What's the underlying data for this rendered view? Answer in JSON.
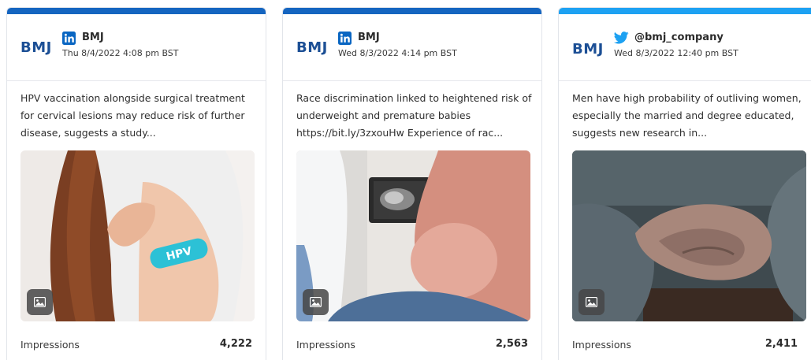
{
  "colors": {
    "linkedin_bar": "#1565c0",
    "twitter_bar": "#1da1f2",
    "linkedin_icon": "#0a66c2",
    "twitter_icon": "#1da1f2",
    "bmj_logo": "#1c4f95"
  },
  "cards": [
    {
      "network_icon": "linkedin-icon",
      "logo_text": "BMJ",
      "author": "BMJ",
      "timestamp": "Thu 8/4/2022 4:08 pm BST",
      "text": "HPV vaccination alongside surgical treatment for cervical lesions may reduce risk of further disease, suggests a study...",
      "image_icon": "image-icon",
      "image_label": "HPV",
      "metric_label": "Impressions",
      "metric_value": "4,222"
    },
    {
      "network_icon": "linkedin-icon",
      "logo_text": "BMJ",
      "author": "BMJ",
      "timestamp": "Wed 8/3/2022 4:14 pm BST",
      "text": "Race discrimination linked to heightened risk of underweight and premature babies https://bit.ly/3zxouHw Experience of rac...",
      "image_icon": "image-icon",
      "metric_label": "Impressions",
      "metric_value": "2,563"
    },
    {
      "network_icon": "twitter-icon",
      "logo_text": "BMJ",
      "author": "@bmj_company",
      "timestamp": "Wed 8/3/2022 12:40 pm BST",
      "text": "Men have high probability of outliving women, especially the married and degree educated, suggests new research in...",
      "image_icon": "image-icon",
      "metric_label": "Impressions",
      "metric_value": "2,411"
    }
  ]
}
